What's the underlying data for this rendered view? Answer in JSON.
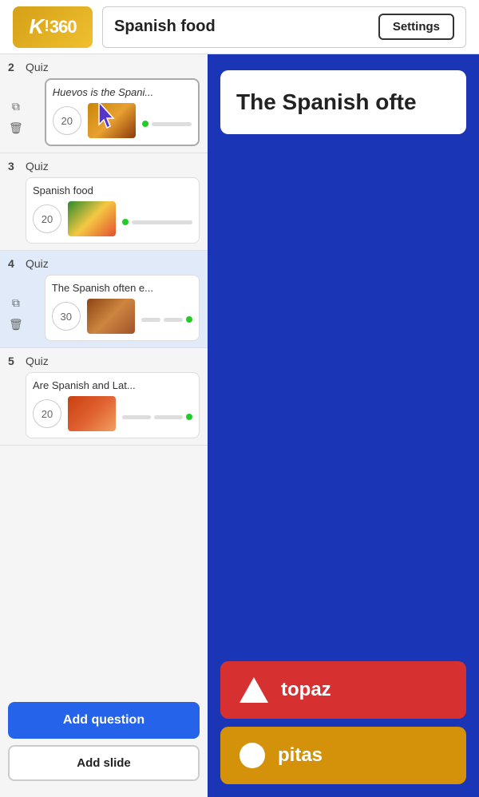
{
  "header": {
    "logo_text": "K!360",
    "title": "Spanish food",
    "settings_label": "Settings"
  },
  "sidebar": {
    "items": [
      {
        "number": "2",
        "type": "Quiz",
        "title": "Huevos is the Spani...",
        "points": "20",
        "selected": true,
        "italic": true
      },
      {
        "number": "3",
        "type": "Quiz",
        "title": "Spanish food",
        "points": "20",
        "selected": false,
        "italic": false
      },
      {
        "number": "4",
        "type": "Quiz",
        "title": "The Spanish often e...",
        "points": "30",
        "selected": false,
        "active": true,
        "italic": false
      },
      {
        "number": "5",
        "type": "Quiz",
        "title": "Are Spanish and Lat...",
        "points": "20",
        "selected": false,
        "italic": false
      }
    ],
    "add_question_label": "Add question",
    "add_slide_label": "Add slide"
  },
  "content": {
    "question_text": "The Spanish ofte",
    "answers": [
      {
        "shape": "triangle",
        "text": "topaz",
        "color": "red"
      },
      {
        "shape": "circle",
        "text": "pitas",
        "color": "gold"
      }
    ]
  }
}
